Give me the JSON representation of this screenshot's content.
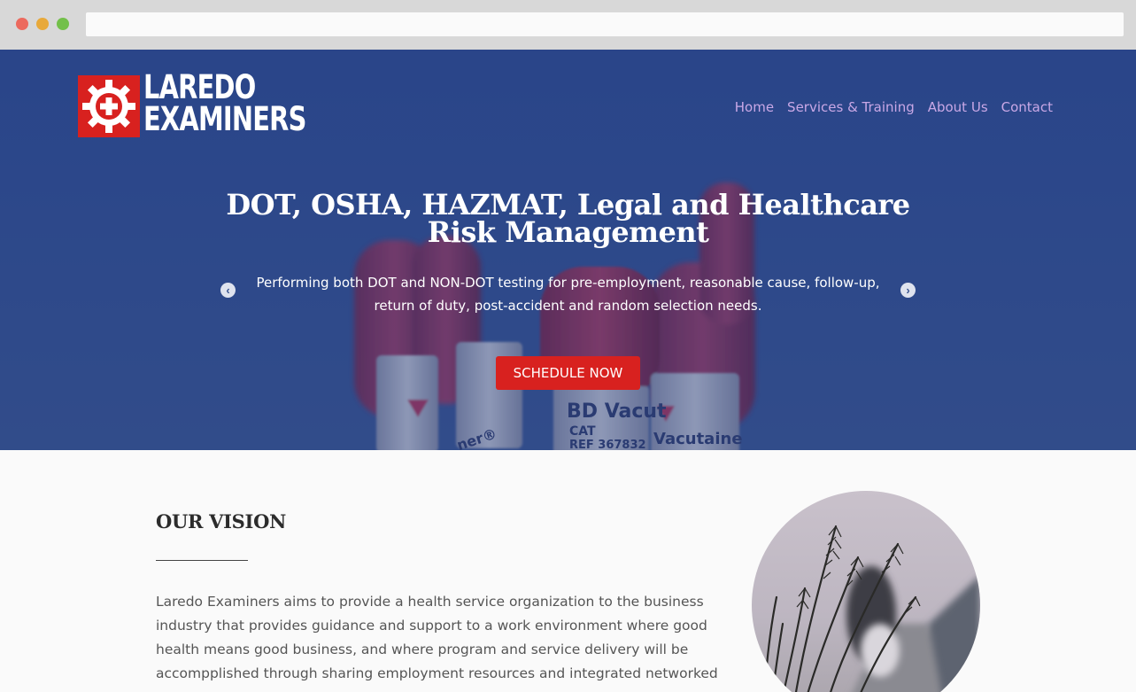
{
  "browser": {
    "window_controls": [
      "close",
      "minimize",
      "maximize"
    ],
    "address": ""
  },
  "header": {
    "logo": {
      "line1": "LAREDO",
      "line2": "EXAMINERS",
      "icon": "gear-medical-cross-icon"
    },
    "nav": [
      {
        "label": "Home"
      },
      {
        "label": "Services & Training"
      },
      {
        "label": "About Us"
      },
      {
        "label": "Contact"
      }
    ]
  },
  "hero": {
    "title_line1": "DOT, OSHA, HAZMAT, Legal and Healthcare",
    "title_line2": "Risk Management",
    "subtitle": "Performing both DOT and NON-DOT testing for pre-employment, reasonable cause, follow-up, return of duty, post-accident and random selection needs.",
    "cta_label": "SCHEDULE NOW",
    "prev_icon": "chevron-left-icon",
    "next_icon": "chevron-right-icon",
    "background_labels": [
      "BD Vacut",
      "CAT",
      "REF 367832",
      "Vacutaine",
      "ner®"
    ]
  },
  "vision": {
    "title": "OUR VISION",
    "text": "Laredo Examiners aims to provide a health service organization to the business industry that provides guidance and support to a work environment where good health means good business, and where program and service delivery will be accompplished through sharing employment resources and integrated networked teams."
  },
  "colors": {
    "brand_red": "#d8211f",
    "hero_blue": "#34508f",
    "nav_link": "#c9a8e6"
  }
}
